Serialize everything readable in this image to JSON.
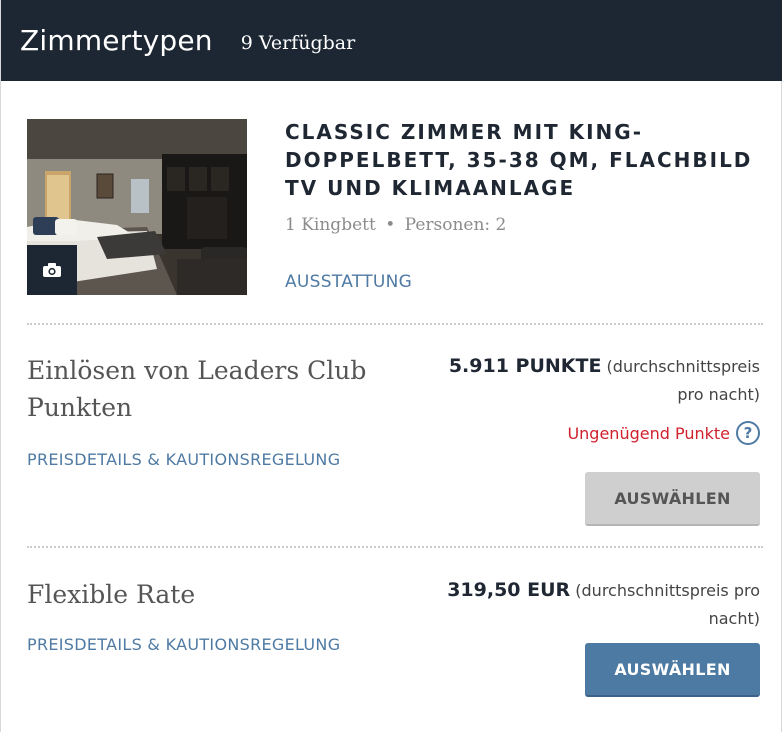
{
  "header": {
    "title": "Zimmertypen",
    "availability": "9 Verfügbar"
  },
  "room": {
    "name": "CLASSIC ZIMMER MIT KING-DOPPELBETT, 35-38 QM, FLACHBILD TV UND KLIMAANLAGE",
    "bed": "1 Kingbett",
    "separator": "•",
    "guests": "Personen: 2",
    "amenities_link": "AUSSTATTUNG",
    "photo_icon": "camera-icon"
  },
  "rates": [
    {
      "name": "Einlösen von Leaders Club Punkten",
      "link": "PREISDETAILS & KAUTIONSREGELUNG",
      "amount": "5.911 PUNKTE",
      "per_night": "(durchschnittspreis pro nacht)",
      "warning": "Ungenügend Punkte",
      "help_icon": "?",
      "button": "AUSWÄHLEN",
      "button_state": "disabled"
    },
    {
      "name": "Flexible Rate",
      "link": "PREISDETAILS & KAUTIONSREGELUNG",
      "amount": "319,50 EUR",
      "per_night": "(durchschnittspreis pro nacht)",
      "button": "AUSWÄHLEN",
      "button_state": "enabled"
    }
  ],
  "colors": {
    "header_bg": "#1d2733",
    "link": "#4f7aa3",
    "warning": "#d0212d",
    "button_primary": "#4d7aa3",
    "button_disabled": "#cfcfcf"
  }
}
